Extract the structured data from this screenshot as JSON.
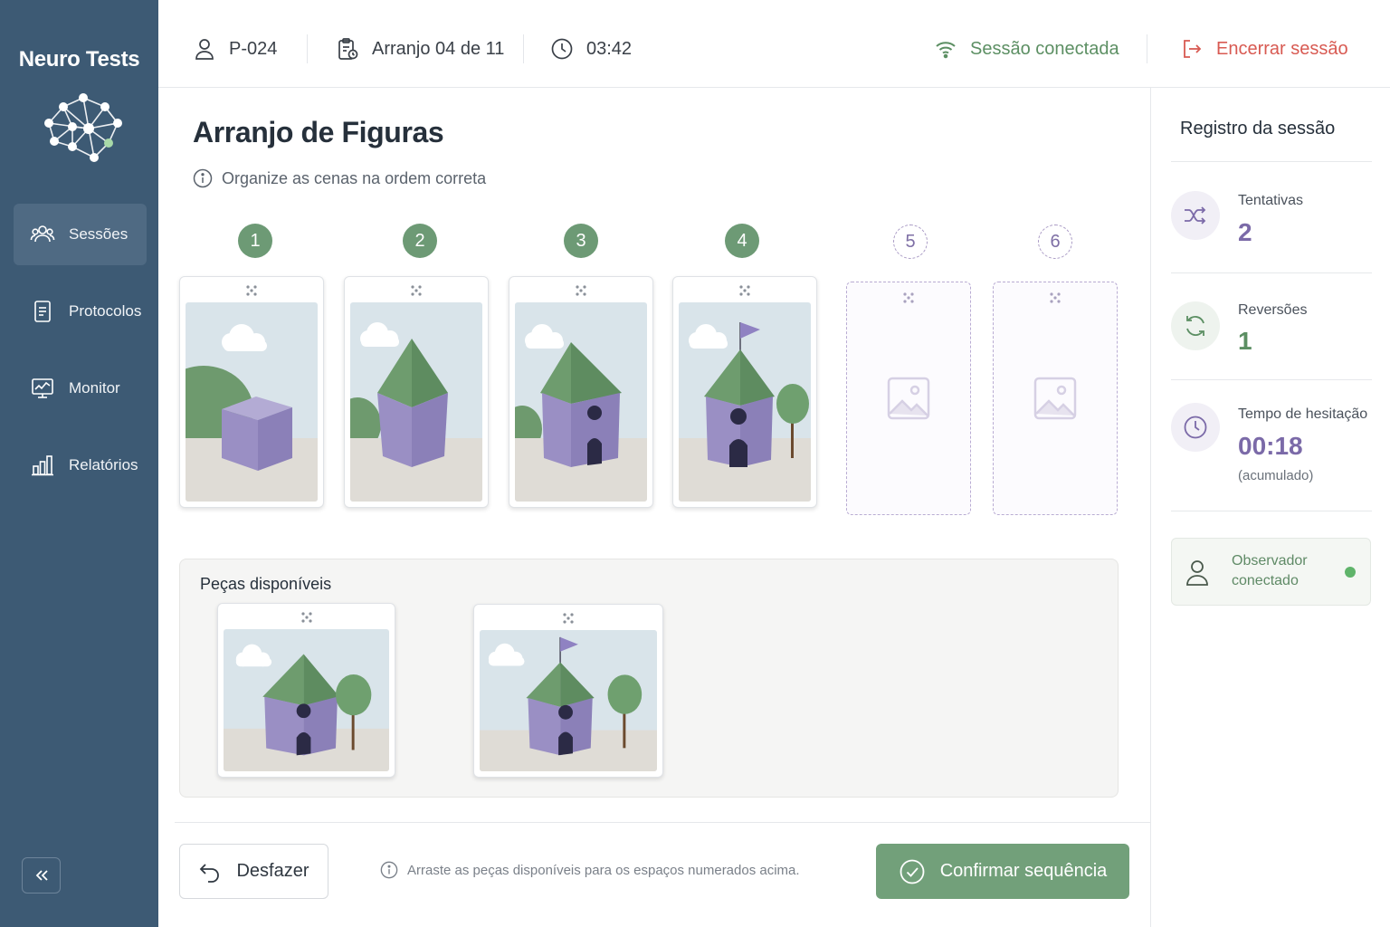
{
  "app": {
    "name": "Neuro Tests"
  },
  "sidebar": {
    "items": [
      {
        "label": "Sessões",
        "icon": "users-icon",
        "active": true
      },
      {
        "label": "Protocolos",
        "icon": "document-icon",
        "active": false
      },
      {
        "label": "Monitor",
        "icon": "monitor-icon",
        "active": false
      },
      {
        "label": "Relatórios",
        "icon": "bar-chart-icon",
        "active": false
      }
    ],
    "collapse_icon": "double-chevron-left-icon"
  },
  "topbar": {
    "participant": "P-024",
    "arrangement": "Arranjo 04 de 11",
    "timer": "03:42",
    "connection": "Sessão conectada",
    "end_session": "Encerrar sessão"
  },
  "main": {
    "title": "Arranjo de Figuras",
    "subtitle": "Organize as cenas na ordem correta",
    "slots": [
      {
        "number": "1",
        "filled": true,
        "scene": "cube"
      },
      {
        "number": "2",
        "filled": true,
        "scene": "roofed"
      },
      {
        "number": "3",
        "filled": true,
        "scene": "house"
      },
      {
        "number": "4",
        "filled": true,
        "scene": "house-flag-tree"
      },
      {
        "number": "5",
        "filled": false
      },
      {
        "number": "6",
        "filled": false
      }
    ],
    "available": {
      "title": "Peças disponíveis",
      "pieces": [
        {
          "scene": "house-tree"
        },
        {
          "scene": "house-flag-tree"
        }
      ]
    },
    "undo_label": "Desfazer",
    "hint": "Arraste as peças disponíveis para os espaços numerados acima.",
    "confirm_label": "Confirmar sequência"
  },
  "right_panel": {
    "title": "Registro da sessão",
    "stats": [
      {
        "label": "Tentativas",
        "value": "2",
        "icon": "shuffle-icon",
        "color": "#7b6aa8"
      },
      {
        "label": "Reversões",
        "value": "1",
        "icon": "refresh-icon",
        "color": "#5c8f63"
      },
      {
        "label": "Tempo de hesitação",
        "value": "00:18",
        "sub": "(acumulado)",
        "icon": "clock-icon",
        "color": "#7b6aa8"
      }
    ],
    "observer": "Observador conectado"
  },
  "colors": {
    "sidebar": "#3d5a74",
    "accent_green": "#72a07a",
    "accent_purple": "#7b6aa8",
    "danger": "#d85a52"
  }
}
